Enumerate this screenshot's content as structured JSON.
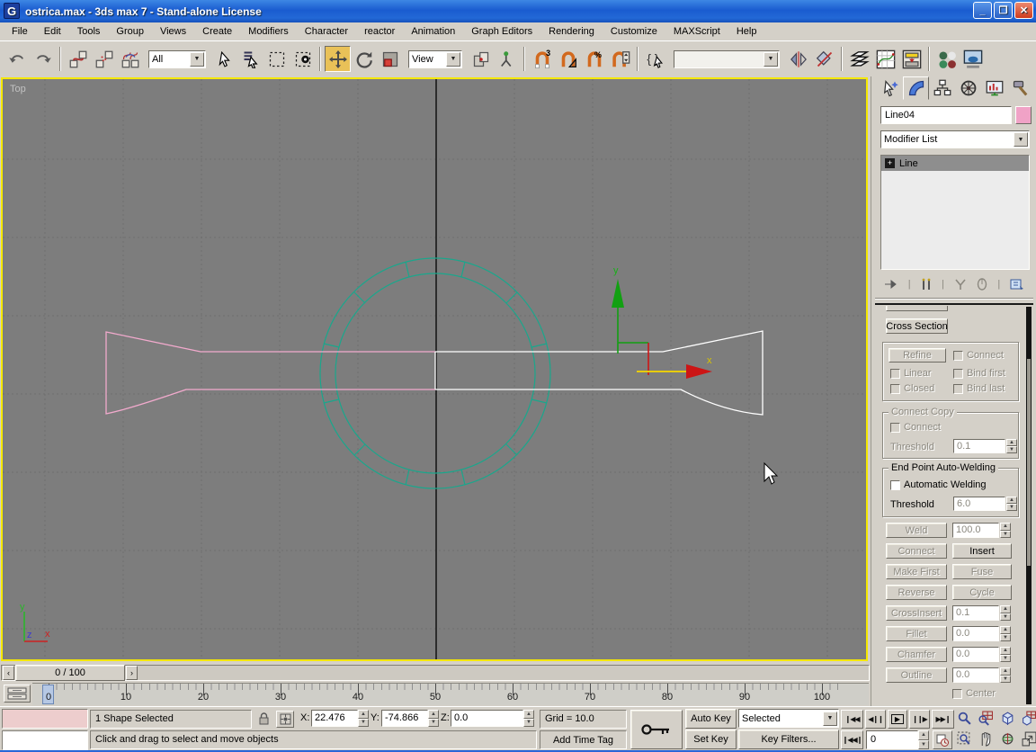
{
  "window": {
    "title": "ostrica.max - 3ds max 7  - Stand-alone License"
  },
  "menu": {
    "items": [
      "File",
      "Edit",
      "Tools",
      "Group",
      "Views",
      "Create",
      "Modifiers",
      "Character",
      "reactor",
      "Animation",
      "Graph Editors",
      "Rendering",
      "Customize",
      "MAXScript",
      "Help"
    ]
  },
  "toolbar": {
    "selection_filter_value": "All",
    "coord_system_value": "View",
    "named_sets_value": "",
    "icons": [
      "undo-icon",
      "redo-icon",
      "select-and-link-icon",
      "unlink-selection-icon",
      "bind-to-spacewarp-icon",
      "select-object-icon",
      "select-by-name-icon",
      "rectangular-selection-region-icon",
      "window-crossing-icon",
      "select-and-move-icon",
      "select-and-rotate-icon",
      "select-and-scale-icon",
      "use-pivot-center-icon",
      "select-and-manipulate-icon",
      "snap-toggle-3d-icon",
      "angle-snap-icon",
      "percent-snap-icon",
      "spinner-snap-icon",
      "named-selection-sets-icon",
      "mirror-icon",
      "align-icon",
      "layer-manager-icon",
      "curve-editor-icon",
      "schematic-view-icon",
      "material-editor-icon",
      "render-scene-icon"
    ]
  },
  "viewport": {
    "label": "Top",
    "gizmo": {
      "x_label": "x",
      "y_label": "y"
    },
    "tripod": {
      "x_label": "x",
      "y_label": "y",
      "z_label": "z"
    }
  },
  "panel": {
    "tabs": [
      "create",
      "modify",
      "hierarchy",
      "motion",
      "display",
      "utilities"
    ],
    "object_name": "Line04",
    "modifier_list": "Modifier List",
    "stack_item": "Line",
    "cross_section": "Cross Section",
    "geometry": {
      "refine": "Refine",
      "connect_cb": "Connect",
      "linear": "Linear",
      "bind_first": "Bind first",
      "closed": "Closed",
      "bind_last": "Bind last",
      "connect_copy_title": "Connect Copy",
      "connect_copy_cb": "Connect",
      "connect_copy_threshold_label": "Threshold",
      "connect_copy_threshold": "0.1",
      "autoweld_title": "End Point Auto-Welding",
      "autoweld_cb": "Automatic Welding",
      "autoweld_threshold_label": "Threshold",
      "autoweld_threshold": "6.0",
      "weld": "Weld",
      "weld_value": "100.0",
      "connect_btn": "Connect",
      "insert": "Insert",
      "make_first": "Make First",
      "fuse": "Fuse",
      "reverse": "Reverse",
      "cycle": "Cycle",
      "cross_insert": "CrossInsert",
      "cross_insert_value": "0.1",
      "fillet": "Fillet",
      "fillet_value": "0.0",
      "chamfer": "Chamfer",
      "chamfer_value": "0.0",
      "outline": "Outline",
      "outline_value": "0.0",
      "center_cb": "Center"
    }
  },
  "timeline": {
    "slider_value": "0 / 100",
    "ticks": [
      "0",
      "10",
      "20",
      "30",
      "40",
      "50",
      "60",
      "70",
      "80",
      "90",
      "100"
    ]
  },
  "status_bar": {
    "selection": "1 Shape Selected",
    "x_label": "X:",
    "y_label": "Y:",
    "z_label": "Z:",
    "x_value": "22.476",
    "y_value": "-74.866",
    "z_value": "0.0",
    "grid": "Grid = 10.0",
    "add_time_tag": "Add Time Tag",
    "prompt": "Click and drag to select and move objects",
    "auto_key": "Auto Key",
    "set_key": "Set Key",
    "selected": "Selected",
    "key_filters": "Key Filters...",
    "frame_value": "0"
  },
  "colors": {
    "viewport_bg": "#7d7d7d",
    "active_viewport_border": "#f5e800",
    "spline_left_pink": "#f2aacd",
    "spline_right_white": "#ffffff",
    "circle_teal": "#1aa78c",
    "object_color_swatch": "#f0a2c6",
    "move_tool_highlight": "#e9c158",
    "titlebar_blue": "#1a5cd0"
  }
}
